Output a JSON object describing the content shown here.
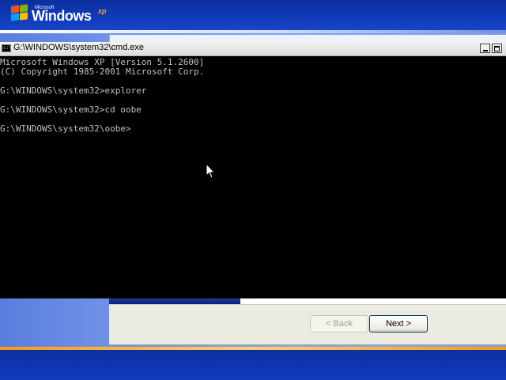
{
  "logo": {
    "small_text": "Microsoft",
    "main_text": "Windows",
    "xp_text": "xp"
  },
  "cmd": {
    "title": "G:\\WINDOWS\\system32\\cmd.exe",
    "icon_label": "c:\\",
    "lines": [
      "Microsoft Windows XP [Version 5.1.2600]",
      "(C) Copyright 1985-2001 Microsoft Corp.",
      "",
      "G:\\WINDOWS\\system32>explorer",
      "",
      "G:\\WINDOWS\\system32>cd oobe",
      "",
      "G:\\WINDOWS\\system32\\oobe>"
    ]
  },
  "wizard": {
    "back_label": "< Back",
    "next_label": "Next >",
    "progress_fraction": 0.33
  },
  "colors": {
    "console_text": "#c0c0c0",
    "console_bg": "#000000",
    "accent_orange": "#f39a1c"
  }
}
